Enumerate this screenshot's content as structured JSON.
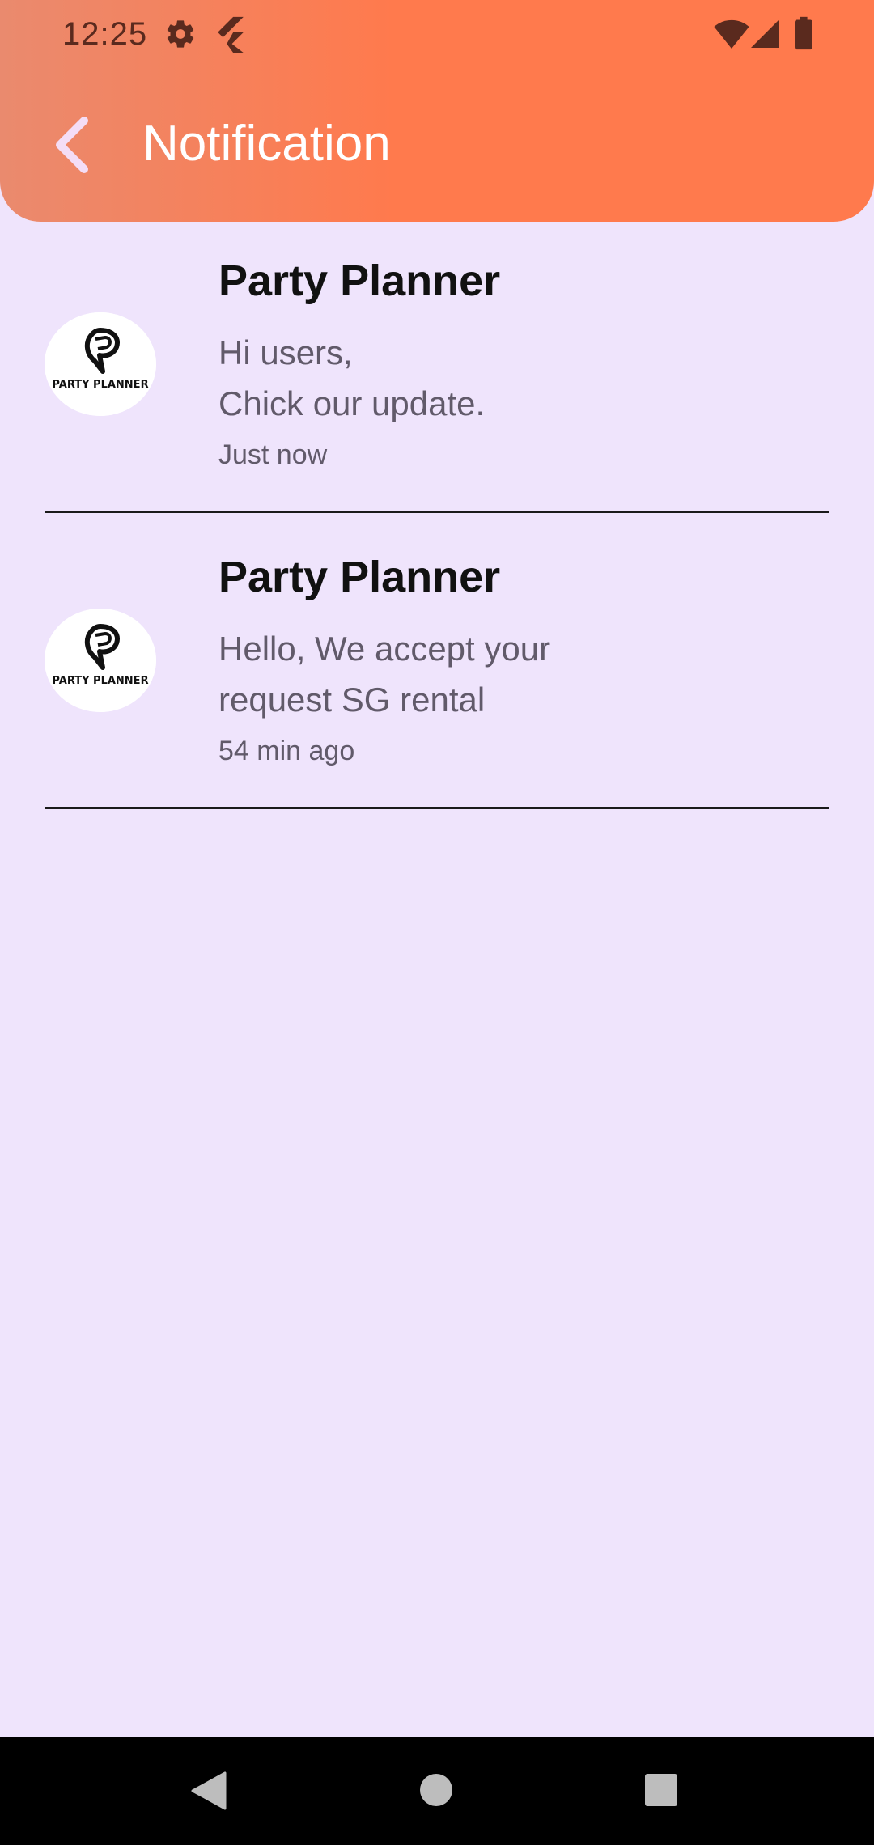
{
  "status_bar": {
    "time": "12:25",
    "icons": [
      "settings-icon",
      "flutter-icon",
      "wifi-icon",
      "signal-icon",
      "battery-icon"
    ]
  },
  "header": {
    "title": "Notification",
    "back_icon": "chevron-left-icon"
  },
  "notifications": [
    {
      "title": "Party Planner",
      "message": "Hi users,\nChick our update.",
      "time": "Just now",
      "avatar_text": "PARTY PLANNER"
    },
    {
      "title": "Party Planner",
      "message": "Hello, We accept your request SG rental",
      "time": "54 min ago",
      "avatar_text": "PARTY PLANNER"
    }
  ],
  "nav_bar": {
    "buttons": [
      "back-triangle-icon",
      "home-circle-icon",
      "recents-square-icon"
    ]
  },
  "colors": {
    "header_start": "#EA8A6E",
    "header_end": "#FF7A4D",
    "background": "#EFE4FC",
    "title_text": "#FFFFFF",
    "secondary_text": "#615A6A"
  }
}
